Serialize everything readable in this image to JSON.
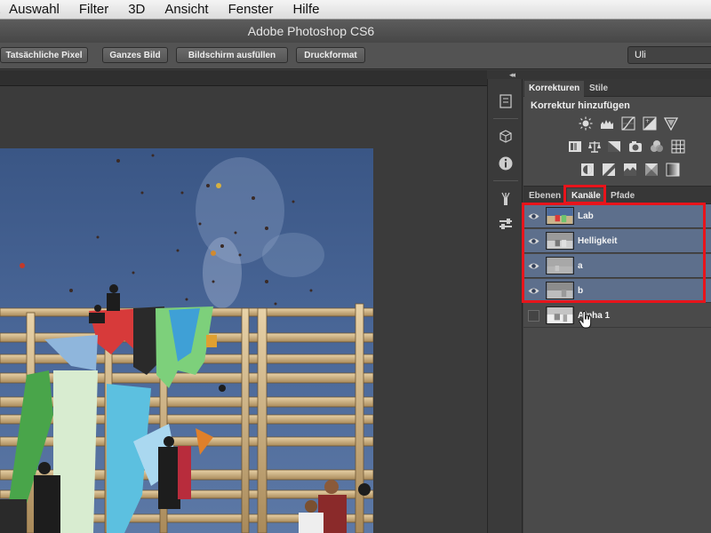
{
  "menubar": {
    "items": [
      "t",
      "Auswahl",
      "Filter",
      "3D",
      "Ansicht",
      "Fenster",
      "Hilfe"
    ]
  },
  "window": {
    "title": "Adobe Photoshop CS6"
  },
  "options_bar": {
    "buttons": [
      "Tatsächliche Pixel",
      "Ganzes Bild",
      "Bildschirm ausfüllen",
      "Druckformat"
    ],
    "workspace_value": "Uli"
  },
  "dock": {
    "collapse_glyph": "◂◂"
  },
  "adjustments_panel": {
    "tabs": [
      "Korrekturen",
      "Stile"
    ],
    "heading": "Korrektur hinzufügen",
    "icons_row1": [
      "brightness-contrast-icon",
      "levels-icon",
      "curves-icon",
      "exposure-icon",
      "vibrance-icon"
    ],
    "icons_row2": [
      "hue-saturation-icon",
      "color-balance-icon",
      "black-white-icon",
      "photo-filter-icon",
      "channel-mixer-icon",
      "color-lookup-icon"
    ],
    "icons_row3": [
      "invert-icon",
      "posterize-icon",
      "threshold-icon",
      "selective-color-icon",
      "gradient-map-icon"
    ]
  },
  "channels_panel": {
    "tabs": [
      "Ebenen",
      "Kanäle",
      "Pfade"
    ],
    "active_tab": "Kanäle",
    "channels": [
      {
        "name": "Lab",
        "visible": true,
        "selected": true
      },
      {
        "name": "Helligkeit",
        "visible": true,
        "selected": true
      },
      {
        "name": "a",
        "visible": true,
        "selected": true
      },
      {
        "name": "b",
        "visible": true,
        "selected": true
      },
      {
        "name": "Alpha 1",
        "visible": false,
        "selected": false
      }
    ]
  },
  "colors": {
    "selection_row": "#5d6f8c",
    "highlight_box": "#e8141b",
    "panel_bg": "#4a4a4a"
  }
}
